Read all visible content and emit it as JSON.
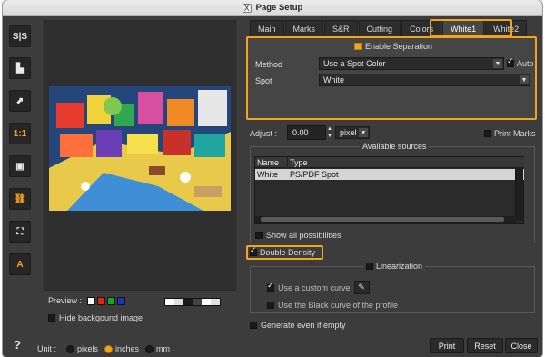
{
  "window": {
    "title": "Page Setup",
    "title_icon": "X"
  },
  "toolbar": [
    {
      "name": "sign-stencil-icon",
      "glyph": "S|S",
      "accent": false
    },
    {
      "name": "align-left-icon",
      "glyph": "▙",
      "accent": false
    },
    {
      "name": "fit-arrow-icon",
      "glyph": "⬈",
      "accent": false
    },
    {
      "name": "actual-size-icon",
      "glyph": "1:1",
      "accent": true
    },
    {
      "name": "fit-frame-icon",
      "glyph": "▣",
      "accent": false
    },
    {
      "name": "link-icon",
      "glyph": "⛓",
      "accent": true
    },
    {
      "name": "expand-icon",
      "glyph": "⛶",
      "accent": false
    },
    {
      "name": "auto-text-icon",
      "glyph": "A",
      "accent": true
    }
  ],
  "help": "?",
  "preview": {
    "label": "Preview :",
    "swatches": [
      "#ffffff",
      "#e0261c",
      "#1aa52a",
      "#2233b8"
    ],
    "strip": [
      "#ffffff",
      "#e0e0e0",
      "#1a1a1a",
      "#444444",
      "#ffffff",
      "#e0e0e0"
    ],
    "hide_background": {
      "label": "Hide backgound image",
      "checked": false
    }
  },
  "unit": {
    "label": "Unit :",
    "options": [
      {
        "label": "pixels",
        "selected": false
      },
      {
        "label": "inches",
        "selected": true
      },
      {
        "label": "mm",
        "selected": false
      }
    ]
  },
  "tabs": [
    {
      "label": "Main",
      "active": false
    },
    {
      "label": "Marks",
      "active": false
    },
    {
      "label": "S&R",
      "active": false
    },
    {
      "label": "Cutting",
      "active": false
    },
    {
      "label": "Colors",
      "active": false
    },
    {
      "label": "White1",
      "active": true
    },
    {
      "label": "White2",
      "active": false
    }
  ],
  "separation": {
    "enable_label": "Enable Separation",
    "enabled": true,
    "method_label": "Method",
    "method_value": "Use a Spot Color",
    "auto_label": "Auto",
    "auto_checked": true,
    "spot_label": "Spot",
    "spot_value": "White"
  },
  "adjust": {
    "label": "Adjust :",
    "value": "0.00",
    "unit": "pixel"
  },
  "print_marks": {
    "label": "Print Marks",
    "checked": false
  },
  "sources": {
    "title": "Available sources",
    "columns": [
      "Name",
      "Type"
    ],
    "rows": [
      {
        "name": "White",
        "type": "PS/PDF Spot"
      }
    ],
    "show_all": {
      "label": "Show all possibilities",
      "checked": false
    }
  },
  "double_density": {
    "label": "Double Density",
    "checked": true
  },
  "linearization": {
    "title": "Linearization",
    "checked": false,
    "custom_curve": {
      "label": "Use a custom curve",
      "checked": true
    },
    "black_curve": {
      "label": "Use the Black curve of the profile",
      "checked": false
    }
  },
  "generate_empty": {
    "label": "Generate even if empty",
    "checked": false
  },
  "buttons": {
    "print": "Print",
    "reset": "Reset",
    "close": "Close"
  },
  "colors": {
    "accent": "#f2a51a",
    "panel": "#3c3c3c",
    "field": "#2b2b2b",
    "selection": "#d4d4d4"
  }
}
